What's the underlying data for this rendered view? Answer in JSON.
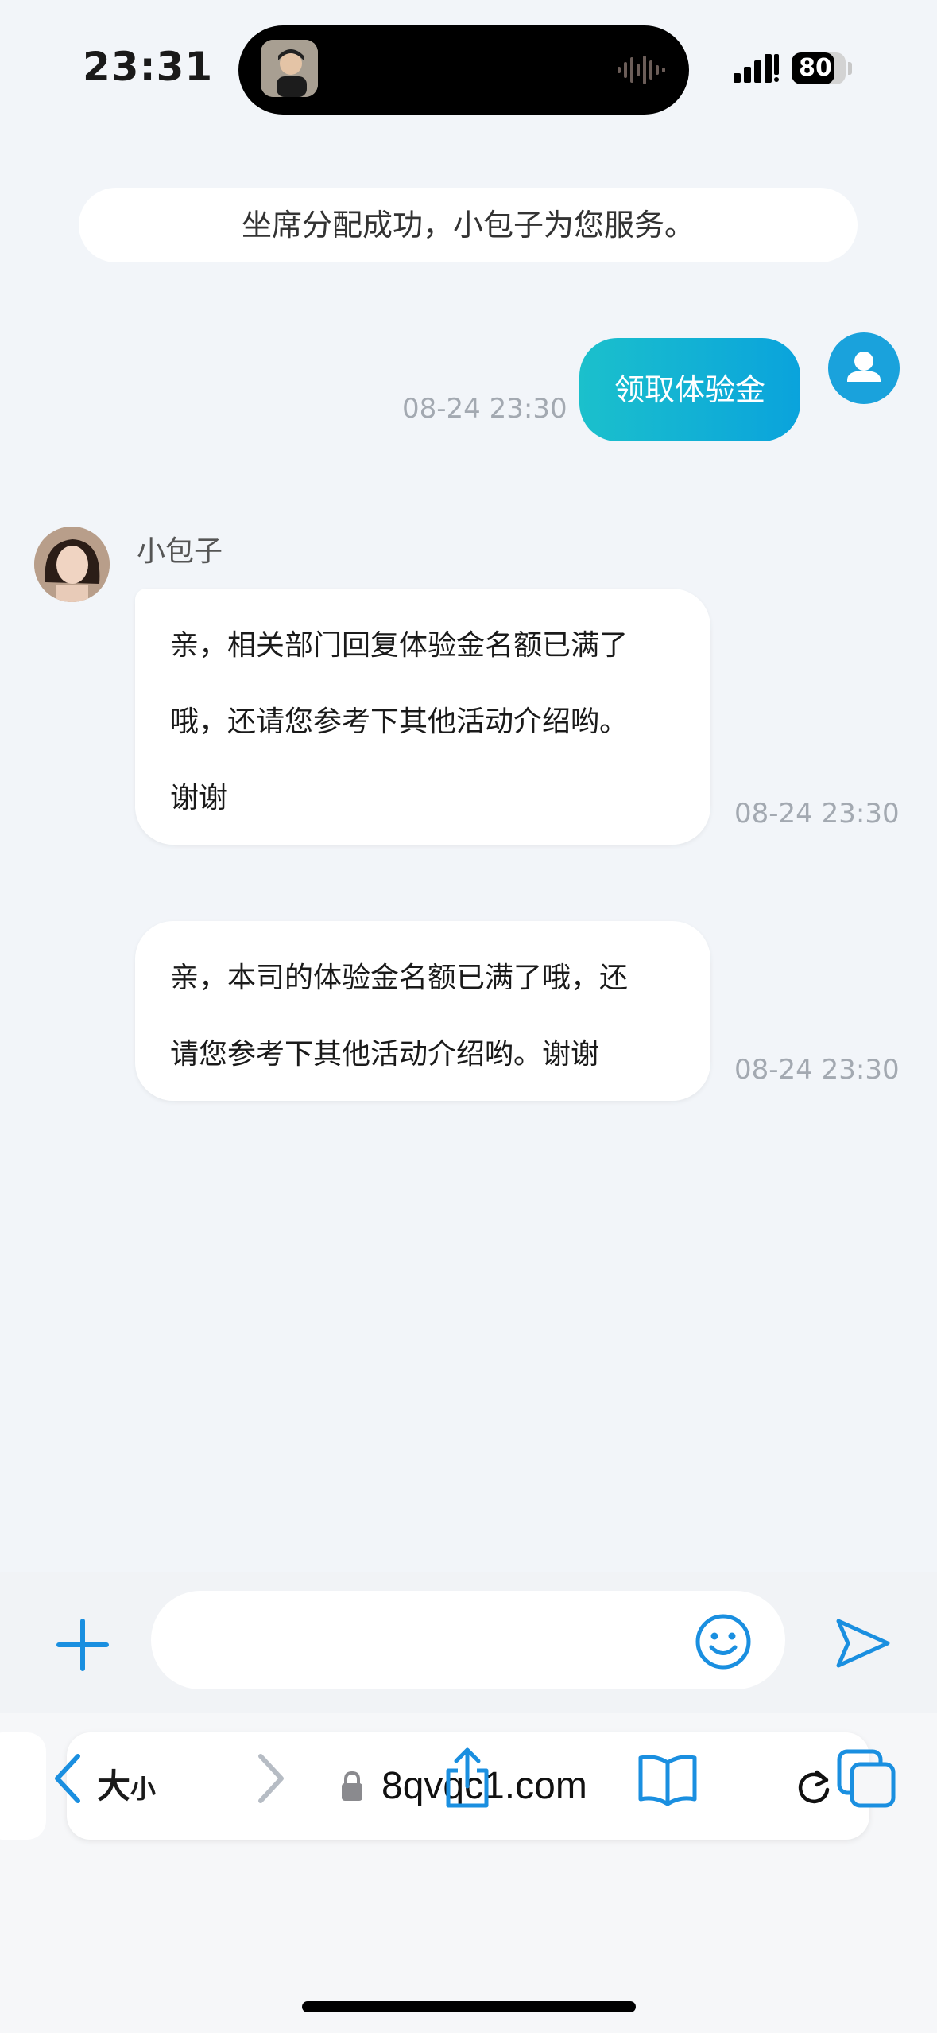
{
  "status_bar": {
    "time": "23:31",
    "battery": "80",
    "battery_level": 0.8
  },
  "chat": {
    "system_notice": "坐席分配成功，小包子为您服务。",
    "user_message": {
      "text": "领取体验金",
      "time": "08-24 23:30"
    },
    "agent": {
      "name": "小包子"
    },
    "agent_messages": [
      {
        "lines": [
          "亲，相关部门回复体验金名额已满了",
          "哦，还请您参考下其他活动介绍哟。",
          "谢谢"
        ],
        "time": "08-24 23:30"
      },
      {
        "lines": [
          "亲，本司的体验金名额已满了哦，还",
          "请您参考下其他活动介绍哟。谢谢"
        ],
        "time": "08-24 23:30"
      }
    ]
  },
  "input_bar": {
    "placeholder": ""
  },
  "browser": {
    "text_size_label_big": "大",
    "text_size_label_small": "小",
    "url": "8qvqc1.com"
  },
  "colors": {
    "accent": "#1aa2dc",
    "bubble_gradient_start": "#1bc0cc",
    "background": "#f2f5f9"
  }
}
